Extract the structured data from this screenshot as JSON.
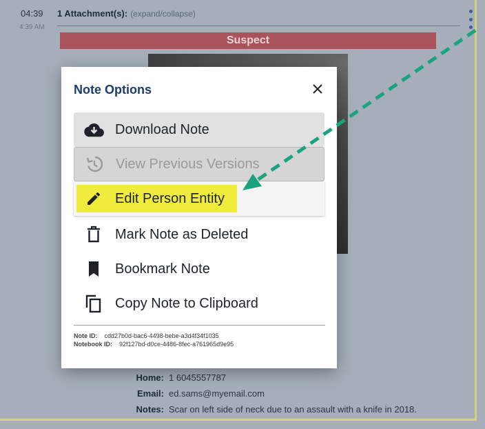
{
  "background": {
    "time": "04:39",
    "time_sub": "4:39 AM",
    "attachments_title": "1 Attachment(s):",
    "attachments_toggle": "(expand/collapse)",
    "banner": "Suspect",
    "details": [
      {
        "label": "Home:",
        "value": "1 6045557787"
      },
      {
        "label": "Email:",
        "value": "ed.sams@myemail.com"
      },
      {
        "label": "Notes:",
        "value": "Scar on left side of neck due to an assault with a knife in 2018."
      }
    ]
  },
  "modal": {
    "title": "Note Options",
    "options": {
      "download": {
        "label": "Download Note",
        "icon": "cloud-download-icon"
      },
      "versions": {
        "label": "View Previous Versions",
        "icon": "history-icon"
      },
      "edit": {
        "label": "Edit Person Entity",
        "icon": "pencil-icon"
      },
      "delete": {
        "label": "Mark Note as Deleted",
        "icon": "trash-icon"
      },
      "bookmark": {
        "label": "Bookmark Note",
        "icon": "bookmark-icon"
      },
      "copy": {
        "label": "Copy Note to Clipboard",
        "icon": "copy-icon"
      }
    },
    "note_id_label": "Note ID:",
    "note_id": "cdd27b0d-bac6-4498-bebe-a3d4f34f1035",
    "notebook_id_label": "Notebook ID:",
    "notebook_id": "92f127bd-d0ce-4486-8fec-a761965d9e95"
  },
  "colors": {
    "modal_title": "#1d3c6b",
    "highlight": "#f0ec3c",
    "arrow": "#1aa37f",
    "banner": "#a9535d"
  }
}
